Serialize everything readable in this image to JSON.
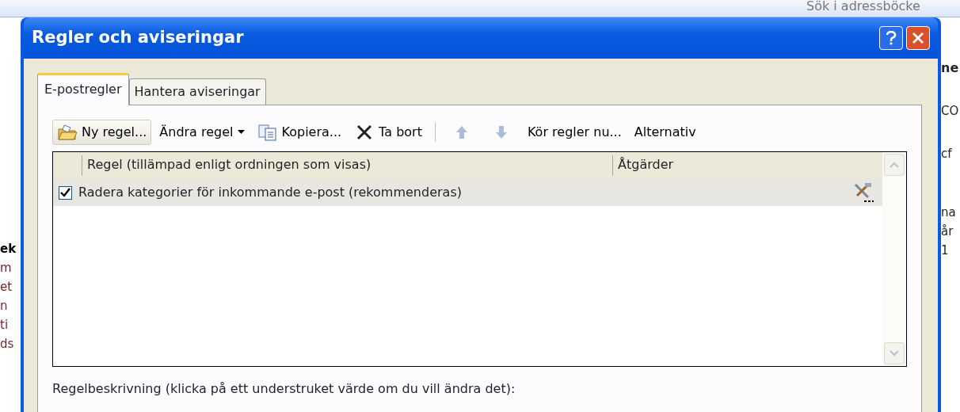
{
  "background": {
    "toolbar_search": "Sök i adressböcke",
    "left_fragments": [
      "ek",
      "m",
      "et",
      "n",
      "ti",
      "ds"
    ],
    "right_fragments": [
      "ne",
      "CO",
      "cf",
      "na",
      "år",
      "1"
    ]
  },
  "window": {
    "title": "Regler och aviseringar"
  },
  "tabs": [
    {
      "label": "E-postregler",
      "selected": true
    },
    {
      "label": "Hantera aviseringar",
      "selected": false
    }
  ],
  "toolbar": [
    {
      "kind": "new",
      "label": "Ny regel..."
    },
    {
      "kind": "menu",
      "label": "Ändra regel"
    },
    {
      "kind": "copy",
      "label": "Kopiera..."
    },
    {
      "kind": "delete",
      "label": "Ta bort"
    },
    {
      "kind": "separator"
    },
    {
      "kind": "up",
      "disabled": true
    },
    {
      "kind": "down",
      "disabled": true
    },
    {
      "kind": "text",
      "label": "Kör regler nu..."
    },
    {
      "kind": "text",
      "label": "Alternativ"
    }
  ],
  "table": {
    "columns": [
      "Regel (tillämpad enligt ordningen som visas)",
      "Åtgärder"
    ],
    "rows": [
      {
        "rule": "Radera kategorier för inkommande e-post (rekommenderas)",
        "checked": true,
        "selected": true
      }
    ]
  },
  "description_label": "Regelbeskrivning (klicka på ett understruket värde om du vill ändra det):"
}
